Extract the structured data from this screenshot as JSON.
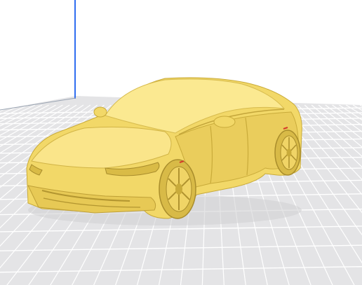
{
  "viewport": {
    "background_color": "#ffffff",
    "build_plate_color": "#e4e4e6",
    "grid_line_color": "#ffffff",
    "z_axis_color": "#2f6df0",
    "x_axis_color": "#e02020"
  },
  "model": {
    "icon": "car-model-icon",
    "body_color": "#f7df72",
    "highlight_color": "#fff0a8",
    "shadow_color": "#c9ab3a",
    "dark_color": "#a98d2c"
  }
}
